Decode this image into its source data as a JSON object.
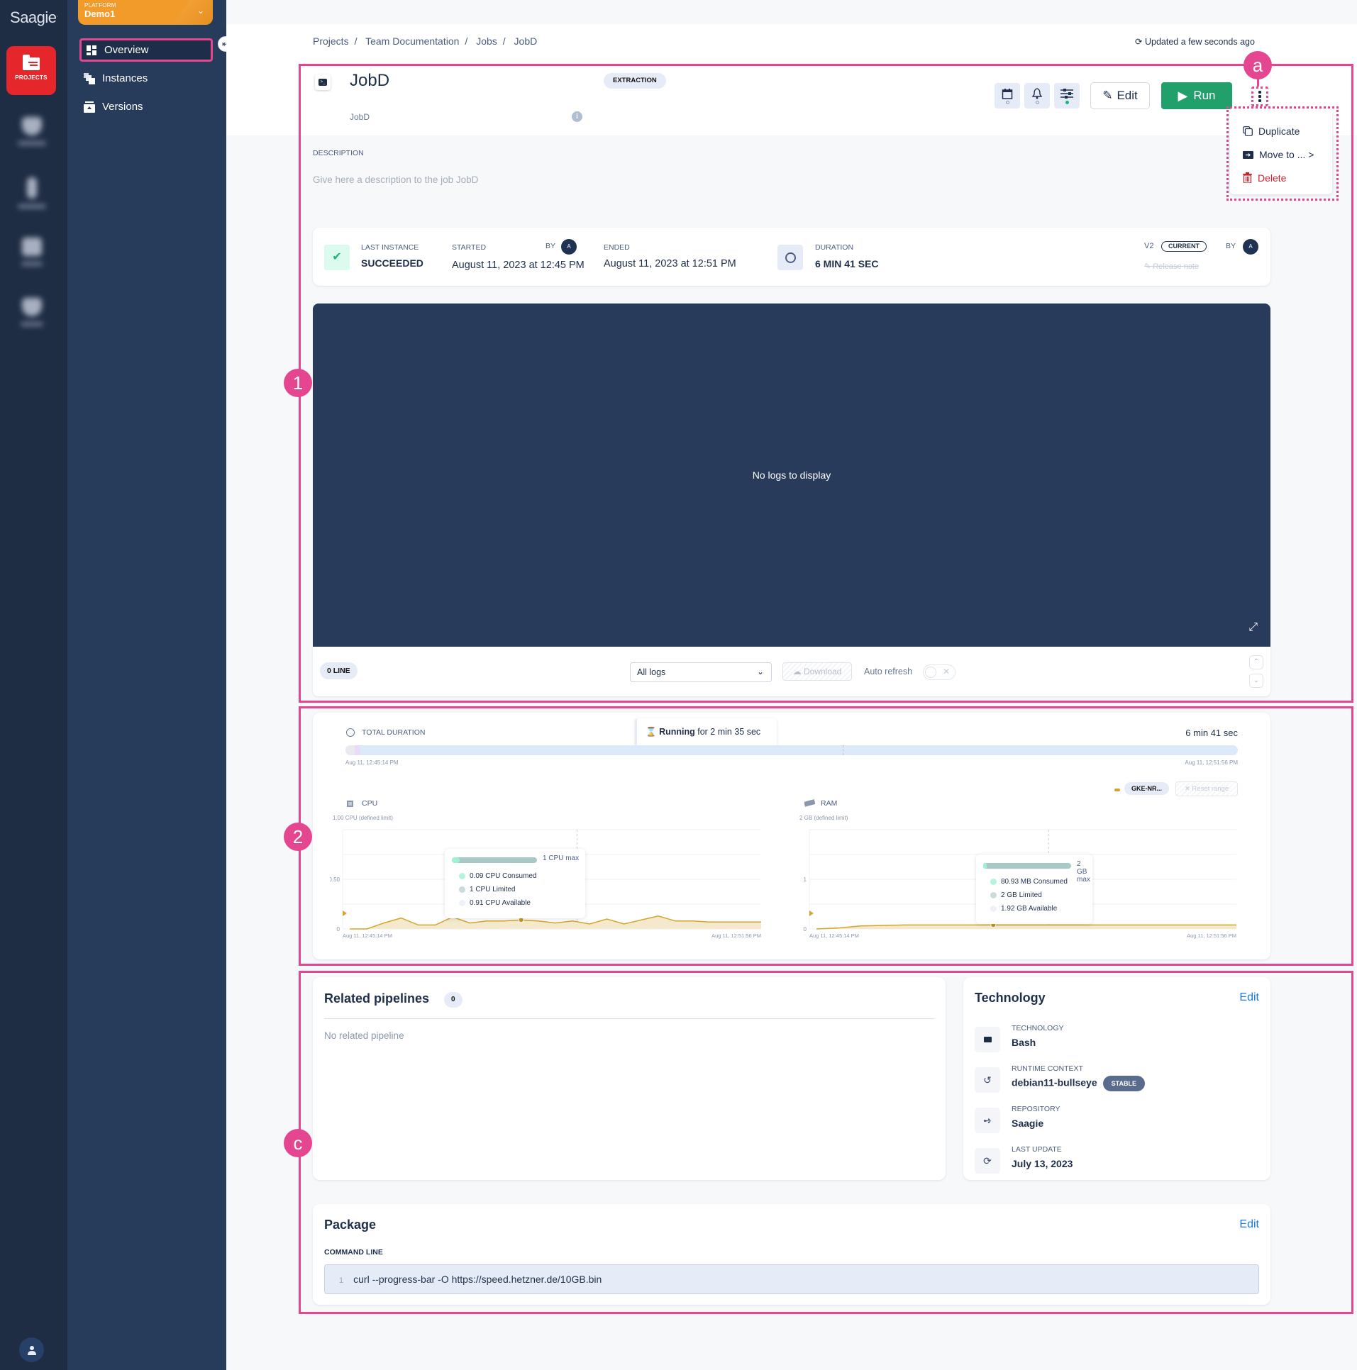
{
  "app": {
    "logo": "Saagie"
  },
  "rail": {
    "projects_label": "PROJECTS",
    "icons": [
      "projects-icon",
      "apps-icon",
      "tool-icon",
      "storage-icon",
      "security-icon",
      "user-icon"
    ]
  },
  "platform": {
    "label": "PLATFORM",
    "name": "Demo1"
  },
  "nav": {
    "items": [
      {
        "label": "Overview",
        "icon": "overview-icon",
        "active": true
      },
      {
        "label": "Instances",
        "icon": "instances-icon",
        "active": false
      },
      {
        "label": "Versions",
        "icon": "versions-icon",
        "active": false
      }
    ]
  },
  "breadcrumb": [
    "Projects",
    "Team Documentation",
    "Jobs",
    "JobD"
  ],
  "breadcrumb_sep": "/",
  "updated": "Updated a few seconds ago",
  "job": {
    "title": "JobD",
    "subtitle": "JobD",
    "category": "EXTRACTION",
    "edit_label": "Edit",
    "run_label": "Run"
  },
  "more_menu": [
    {
      "label": "Duplicate",
      "icon": "duplicate-icon"
    },
    {
      "label": "Move to ... >",
      "icon": "move-folder-icon"
    },
    {
      "label": "Delete",
      "icon": "trash-icon"
    }
  ],
  "markers": {
    "a": "a",
    "one": "1",
    "two": "2",
    "c": "c"
  },
  "description": {
    "label": "DESCRIPTION",
    "placeholder": "Give here a description to the job JobD"
  },
  "last_instance": {
    "label": "LAST INSTANCE",
    "status": "SUCCEEDED",
    "started_label": "STARTED",
    "started": "August 11, 2023 at 12:45 PM",
    "by_label": "BY",
    "by_avatar": "A",
    "ended_label": "ENDED",
    "ended": "August 11, 2023 at 12:51 PM",
    "duration_label": "DURATION",
    "duration": "6 MIN 41 SEC",
    "version": "V2",
    "version_badge": "CURRENT",
    "version_by_label": "BY",
    "version_by_avatar": "A",
    "release_note": "Release note"
  },
  "logs": {
    "empty_message": "No logs to display",
    "line_count": "0 LINE",
    "filter_value": "All logs",
    "download_label": "Download",
    "auto_refresh_label": "Auto refresh",
    "auto_refresh_on": false
  },
  "metrics": {
    "total_duration_label": "TOTAL DURATION",
    "total_duration": "6 min 41 sec",
    "running_prefix": "Running",
    "running_suffix": "for 2 min 35 sec",
    "start_time": "Aug 11, 12:45:14 PM",
    "end_time": "Aug 11, 12:51:56 PM",
    "node_label": "GKE-NR...",
    "reset_range_label": "Reset range",
    "cpu": {
      "title": "CPU",
      "limit_label": "1.00 CPU (defined limit)",
      "y_ticks": [
        "0",
        "0.50"
      ],
      "tooltip": {
        "max_label": "1 CPU max",
        "consumed": "0.09 CPU Consumed",
        "limited": "1 CPU Limited",
        "available": "0.91 CPU Available",
        "consumed_fraction": 0.09
      }
    },
    "ram": {
      "title": "RAM",
      "limit_label": "2 GB (defined limit)",
      "y_ticks": [
        "0",
        "1"
      ],
      "tooltip": {
        "max_label": "2 GB max",
        "consumed": "80.93 MB Consumed",
        "limited": "2 GB Limited",
        "available": "1.92 GB Available",
        "consumed_fraction": 0.04
      }
    }
  },
  "chart_data": [
    {
      "type": "area",
      "title": "CPU",
      "ylabel": "1.00 CPU (defined limit)",
      "ylim": [
        0,
        1
      ],
      "y_ticks": [
        0,
        0.5
      ],
      "x_start": "Aug 11, 12:45:14 PM",
      "x_end": "Aug 11, 12:51:56 PM",
      "series": [
        {
          "name": "GKE-NR...",
          "values": [
            0,
            0,
            0.06,
            0.11,
            0.04,
            0.04,
            0.12,
            0.06,
            0.08,
            0.08,
            0.09,
            0.08,
            0.06,
            0.08,
            0.05,
            0.1,
            0.05,
            0.09,
            0.13,
            0.08,
            0.08,
            0.07,
            0.07,
            0.07,
            0.07
          ]
        }
      ]
    },
    {
      "type": "area",
      "title": "RAM",
      "ylabel": "2 GB (defined limit)",
      "ylim": [
        0,
        2
      ],
      "y_ticks": [
        0,
        1
      ],
      "x_start": "Aug 11, 12:45:14 PM",
      "x_end": "Aug 11, 12:51:56 PM",
      "series": [
        {
          "name": "GKE-NR...",
          "values": [
            0,
            0.02,
            0.06,
            0.07,
            0.08,
            0.08,
            0.08,
            0.08,
            0.08,
            0.08,
            0.08,
            0.08,
            0.08,
            0.08,
            0.08,
            0.08,
            0.08,
            0.08,
            0.08,
            0.08
          ]
        }
      ]
    }
  ],
  "pipelines": {
    "title": "Related pipelines",
    "count": "0",
    "empty": "No related pipeline"
  },
  "technology": {
    "title": "Technology",
    "edit_label": "Edit",
    "rows": [
      {
        "key": "TECHNOLOGY",
        "value": "Bash",
        "icon": "bash-icon"
      },
      {
        "key": "RUNTIME CONTEXT",
        "value": "debian11-bullseye",
        "badge": "STABLE",
        "icon": "history-icon"
      },
      {
        "key": "REPOSITORY",
        "value": "Saagie",
        "icon": "plug-icon"
      },
      {
        "key": "LAST UPDATE",
        "value": "July 13, 2023",
        "icon": "refresh-icon"
      }
    ]
  },
  "package": {
    "title": "Package",
    "edit_label": "Edit",
    "command_label": "COMMAND LINE",
    "lines": [
      {
        "num": "1",
        "text": "curl --progress-bar -O https://speed.hetzner.de/10GB.bin"
      }
    ]
  }
}
